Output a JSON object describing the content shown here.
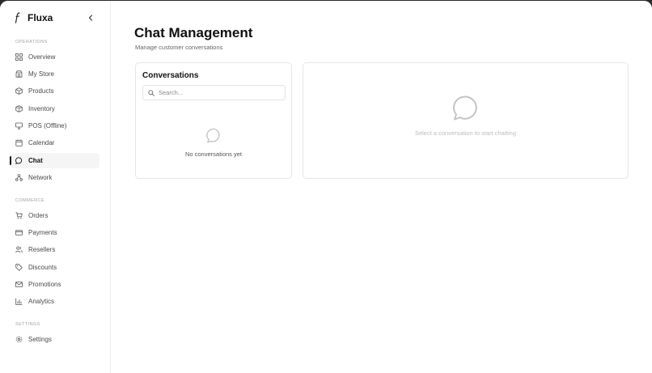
{
  "app": {
    "name": "Fluxa"
  },
  "sidebar": {
    "sections": [
      {
        "label": "OPERATIONS"
      },
      {
        "label": "COMMERCE"
      },
      {
        "label": "SETTINGS"
      }
    ],
    "items": [
      {
        "label": "Overview",
        "icon": "grid-icon"
      },
      {
        "label": "My Store",
        "icon": "store-icon"
      },
      {
        "label": "Products",
        "icon": "box-icon"
      },
      {
        "label": "Inventory",
        "icon": "package-icon"
      },
      {
        "label": "POS (Offline)",
        "icon": "monitor-icon"
      },
      {
        "label": "Calendar",
        "icon": "calendar-icon"
      },
      {
        "label": "Chat",
        "icon": "chat-icon",
        "active": true
      },
      {
        "label": "Network",
        "icon": "network-icon"
      },
      {
        "label": "Orders",
        "icon": "cart-icon"
      },
      {
        "label": "Payments",
        "icon": "credit-card-icon"
      },
      {
        "label": "Resellers",
        "icon": "users-icon"
      },
      {
        "label": "Discounts",
        "icon": "tag-icon"
      },
      {
        "label": "Promotions",
        "icon": "mail-icon"
      },
      {
        "label": "Analytics",
        "icon": "bar-chart-icon"
      },
      {
        "label": "Settings",
        "icon": "gear-icon"
      }
    ]
  },
  "main": {
    "title": "Chat Management",
    "subtitle": "Manage customer conversations",
    "conversations": {
      "title": "Conversations",
      "search_placeholder": "Search...",
      "empty_text": "No conversations yet"
    },
    "chat_panel": {
      "empty_text": "Select a conversation to start chatting"
    }
  },
  "colors": {
    "accent": "#111111",
    "muted": "#a3a3a3",
    "border": "#e6e6e6"
  }
}
